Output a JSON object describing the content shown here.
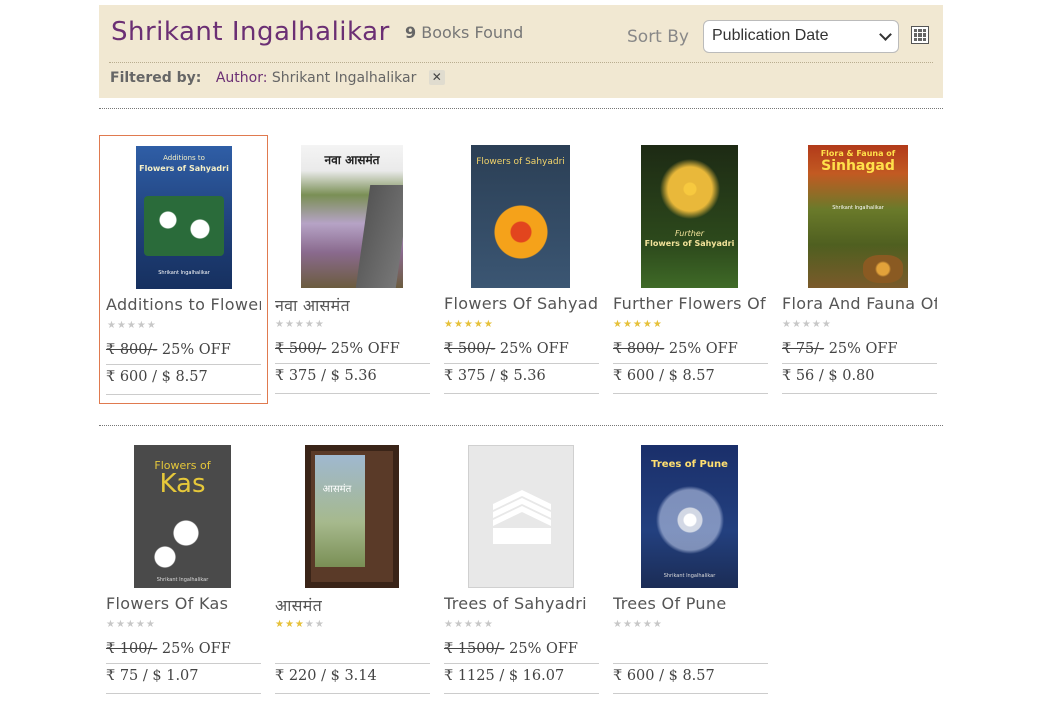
{
  "header": {
    "author": "Shrikant Ingalhalikar",
    "count": "9",
    "count_label": "Books Found",
    "sort_label": "Sort By",
    "sort_value": "Publication Date",
    "filter_label": "Filtered by:",
    "filter_key": "Author:",
    "filter_value": "Shrikant Ingalhalikar",
    "filter_remove": "✕"
  },
  "books": [
    {
      "title": "Additions to Flowers of Sahyadri",
      "mrp": "₹ 800/-",
      "discount": "25% OFF",
      "price": "₹ 600 / $ 8.57",
      "rating": 0,
      "cover": {
        "line1": "Additions to",
        "line2": "Flowers of Sahyadri",
        "publisher": "Shrikant Ingalhalikar"
      }
    },
    {
      "title": "नवा आसमंत",
      "mrp": "₹ 500/-",
      "discount": "25% OFF",
      "price": "₹ 375 / $ 5.36",
      "rating": 0,
      "cover": {
        "line1": "नवा",
        "line2": "आसमंत"
      }
    },
    {
      "title": "Flowers Of Sahyadri",
      "mrp": "₹ 500/-",
      "discount": "25% OFF",
      "price": "₹ 375 / $ 5.36",
      "rating": 5,
      "cover": {
        "line1": "Flowers of Sahyadri"
      }
    },
    {
      "title": "Further Flowers Of Sahyadri",
      "mrp": "₹ 800/-",
      "discount": "25% OFF",
      "price": "₹ 600 / $ 8.57",
      "rating": 5,
      "cover": {
        "line1": "Further",
        "line2": "Flowers of Sahyadri"
      }
    },
    {
      "title": "Flora And Fauna Of Sinhagad",
      "mrp": "₹ 75/-",
      "discount": "25% OFF",
      "price": "₹ 56 / $ 0.80",
      "rating": 0,
      "cover": {
        "line1": "Flora & Fauna of",
        "line2": "Sinhagad",
        "publisher": "Shrikant Ingalhalikar"
      }
    },
    {
      "title": "Flowers Of Kas",
      "mrp": "₹ 100/-",
      "discount": "25% OFF",
      "price": "₹ 75 / $ 1.07",
      "rating": 0,
      "cover": {
        "line1": "Flowers of",
        "line2": "Kas",
        "publisher": "Shrikant Ingalhalikar"
      }
    },
    {
      "title": "आसमंत",
      "mrp": "",
      "discount": "",
      "price": "₹ 220 / $ 3.14",
      "rating": 3,
      "cover": {
        "line1": "आसमंत"
      }
    },
    {
      "title": "Trees of Sahyadri",
      "mrp": "₹ 1500/-",
      "discount": "25% OFF",
      "price": "₹ 1125 / $ 16.07",
      "rating": 0,
      "cover": {
        "placeholder": true
      }
    },
    {
      "title": "Trees Of Pune",
      "mrp": "",
      "discount": "",
      "price": "₹ 600 / $ 8.57",
      "rating": 0,
      "cover": {
        "line1": "Trees of Pune",
        "publisher": "Shrikant Ingalhalikar"
      }
    }
  ],
  "colors": {
    "header_bg": "#f1e8d2",
    "author": "#6b2f74",
    "star_on": "#e6c13a",
    "star_off": "#c8c8c8",
    "selected_border": "#e07a4f"
  }
}
